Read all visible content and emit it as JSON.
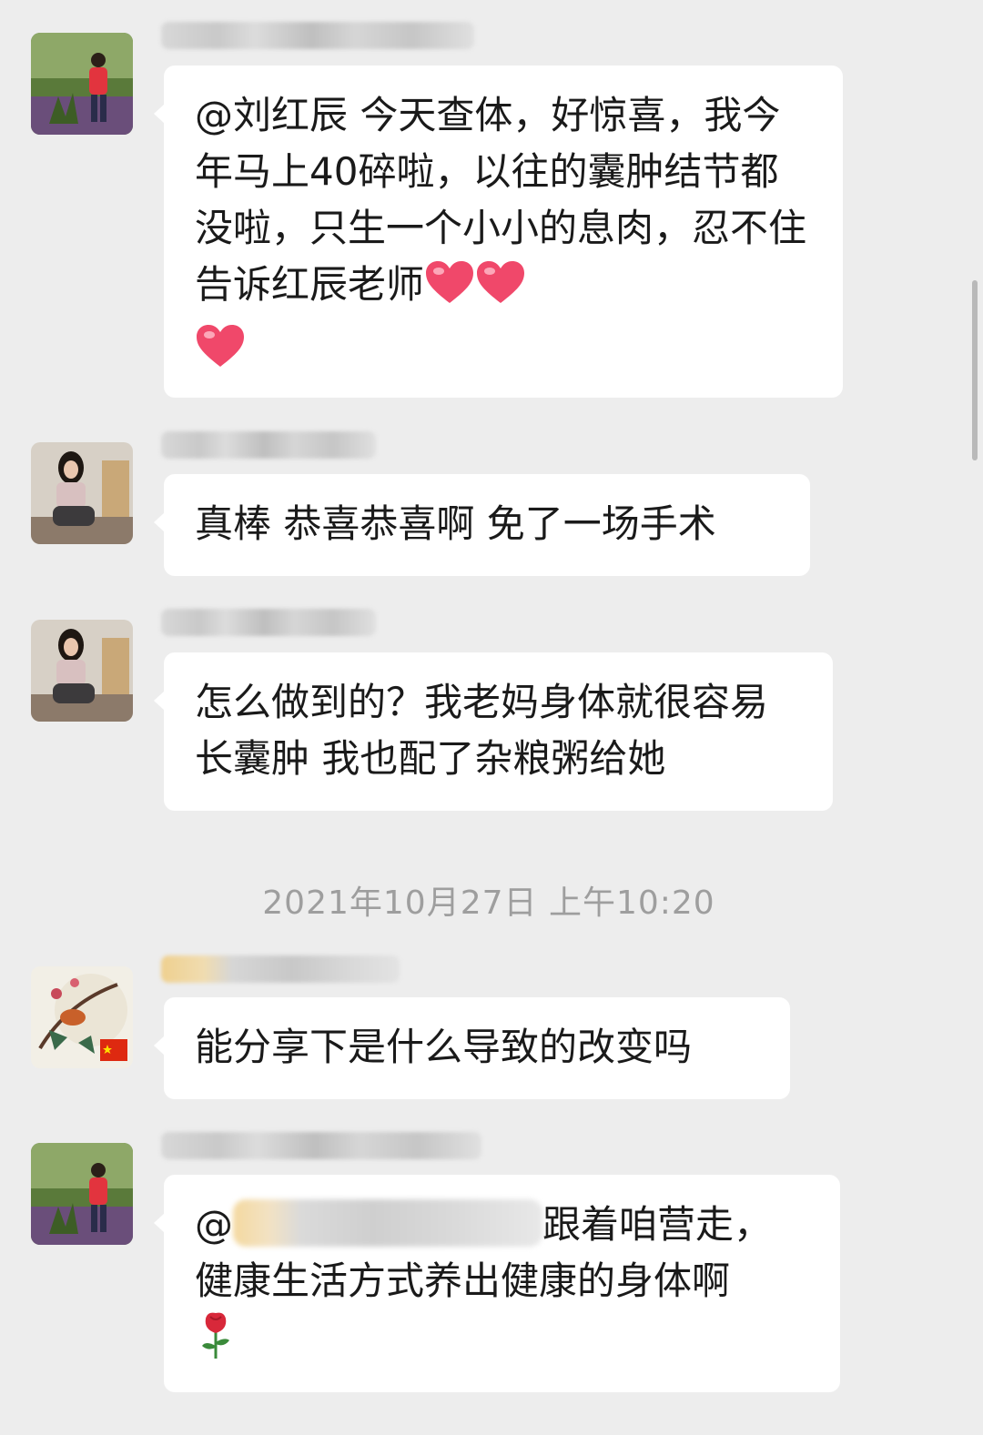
{
  "messages": [
    {
      "text": "@刘红辰 今天查体，好惊喜，我今年马上40碎啦，以往的囊肿结节都没啦，只生一个小小的息肉，忍不住告诉红辰老师",
      "emoji": [
        "heart",
        "heart",
        "heart"
      ]
    },
    {
      "text": "真棒 恭喜恭喜啊 免了一场手术"
    },
    {
      "text": "怎么做到的？我老妈身体就很容易长囊肿 我也配了杂粮粥给她"
    },
    {
      "text": "能分享下是什么导致的改变吗"
    },
    {
      "mention_prefix": "@",
      "mention_suffix": "跟着咱营走，",
      "text_line2": "健康生活方式养出健康的身体啊",
      "emoji": [
        "rose"
      ]
    }
  ],
  "timestamp": "2021年10月27日 上午10:20",
  "colors": {
    "background": "#ededed",
    "bubble": "#ffffff",
    "text": "#1a1a1a",
    "timestamp": "#9e9e9e",
    "heart": "#f0486a"
  }
}
